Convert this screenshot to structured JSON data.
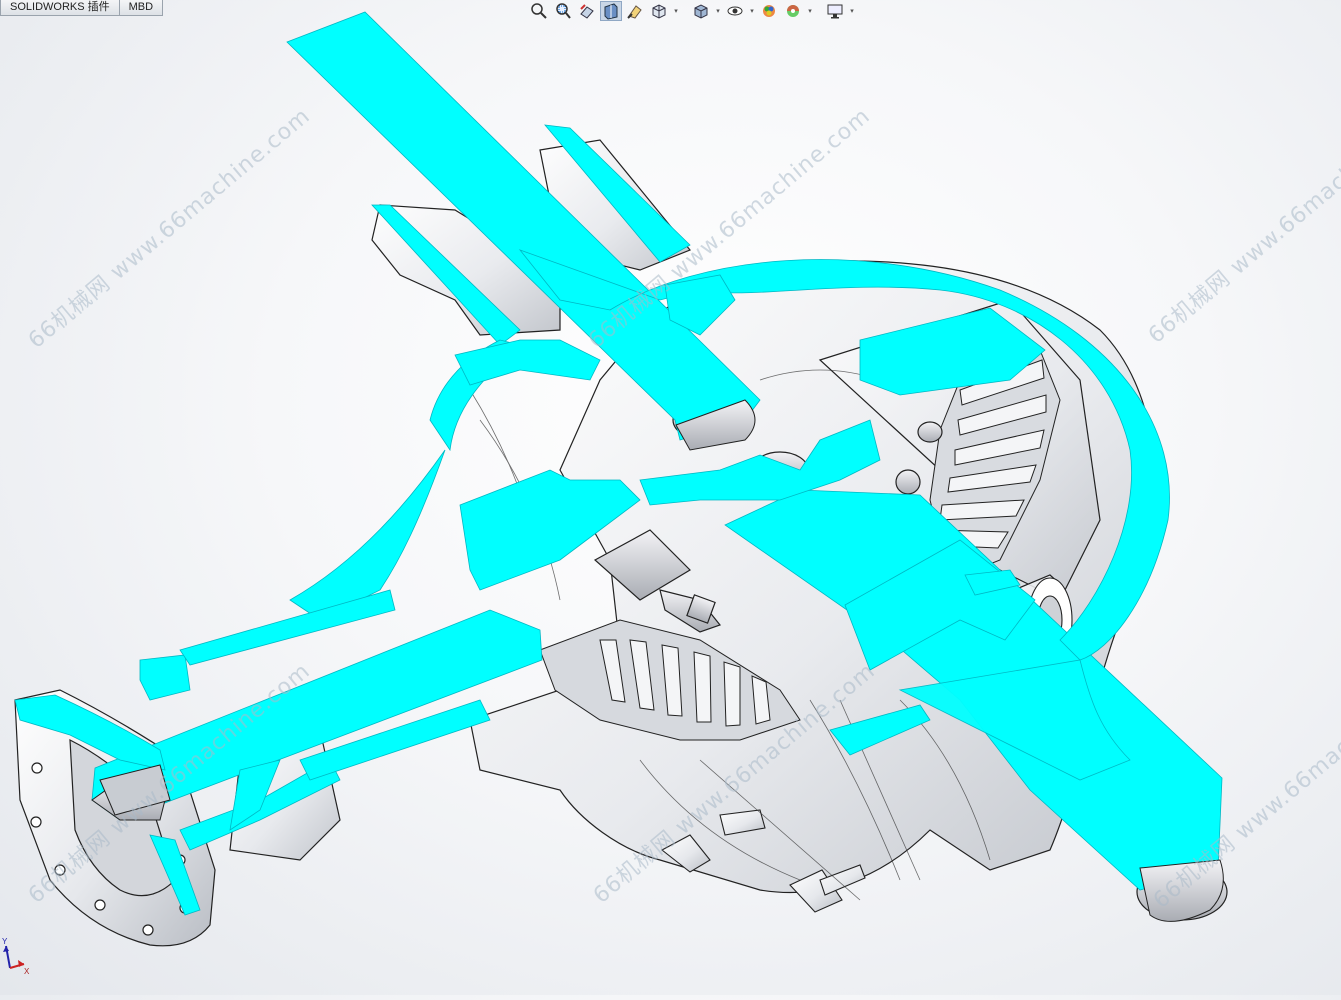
{
  "tabs": [
    {
      "label": "SOLIDWORKS 插件"
    },
    {
      "label": "MBD"
    }
  ],
  "heads_up_toolbar": [
    {
      "icon": "zoom-to-fit-icon",
      "dropdown": false
    },
    {
      "icon": "zoom-to-area-icon",
      "dropdown": false
    },
    {
      "icon": "previous-view-icon",
      "dropdown": false
    },
    {
      "icon": "section-view-icon",
      "dropdown": false,
      "active": true
    },
    {
      "icon": "dynamic-annotation-view-icon",
      "dropdown": false
    },
    {
      "icon": "view-orientation-icon",
      "dropdown": true
    },
    {
      "icon": "display-style-icon",
      "dropdown": true
    },
    {
      "icon": "hide-show-items-icon",
      "dropdown": true
    },
    {
      "icon": "edit-appearance-icon",
      "dropdown": false
    },
    {
      "icon": "apply-scene-icon",
      "dropdown": true
    },
    {
      "icon": "view-settings-icon",
      "dropdown": true
    }
  ],
  "watermark_text": "66机械网 www.66machine.com",
  "triad": {
    "x_label": "X",
    "y_label": "Y"
  },
  "colors": {
    "section_fill": "#00ffff",
    "part_body": "#eceef2",
    "edge": "#1a1a1a",
    "background_center": "#ffffff",
    "background_edge": "#e4e7ec"
  }
}
